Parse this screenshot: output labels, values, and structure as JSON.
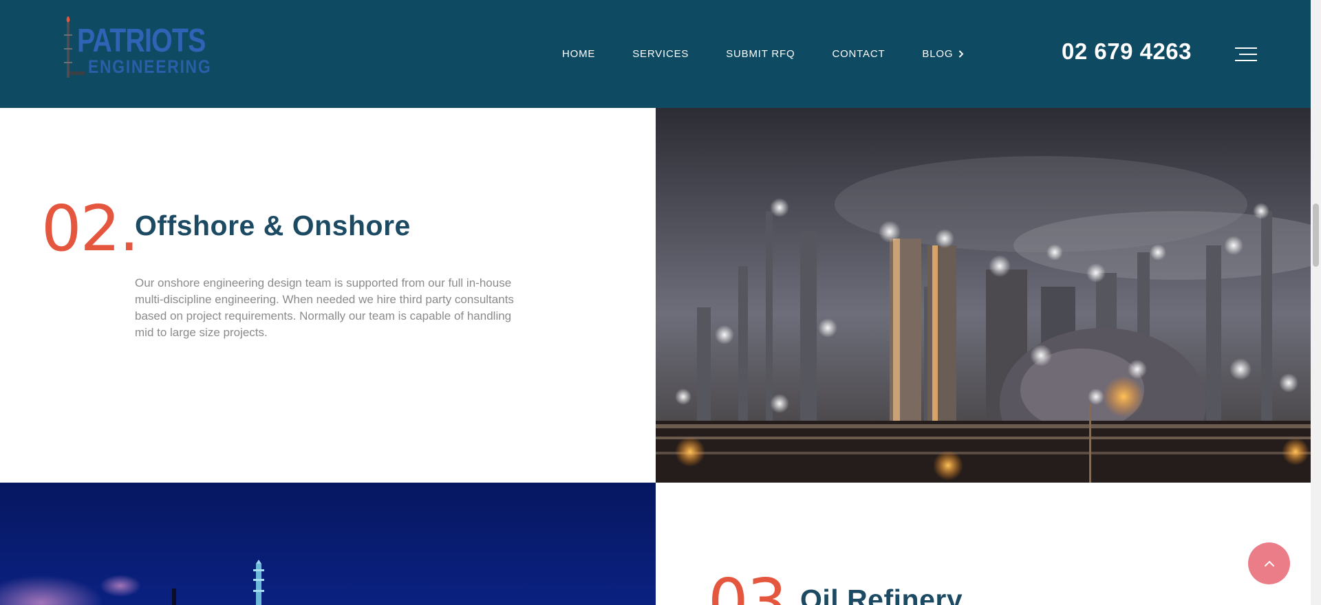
{
  "header": {
    "logo": {
      "line1": "PATRIOTS",
      "line2": "ENGINEERING"
    },
    "nav": [
      {
        "label": "HOME"
      },
      {
        "label": "SERVICES"
      },
      {
        "label": "SUBMIT RFQ"
      },
      {
        "label": "CONTACT"
      },
      {
        "label": "BLOG"
      }
    ],
    "phone": "02 679 4263",
    "menu_icon": "hamburger-menu-icon"
  },
  "sections": [
    {
      "number": "02.",
      "title": "Offshore & Onshore",
      "description": "Our onshore engineering design team is supported from our full in-house multi-discipline engineering. When needed we hire third party consultants based on project requirements. Normally our team is capable of handling mid to large size projects.",
      "image": "refinery-night-photo"
    },
    {
      "number": "03",
      "title": "Oil Refinery",
      "image": "offshore-platform-night-photo"
    }
  ],
  "colors": {
    "header_bg": "#0f4a63",
    "accent_number": "#e4573e",
    "title": "#1c4a63",
    "back_to_top": "#ea7d88"
  },
  "back_to_top_icon": "chevron-up-icon"
}
